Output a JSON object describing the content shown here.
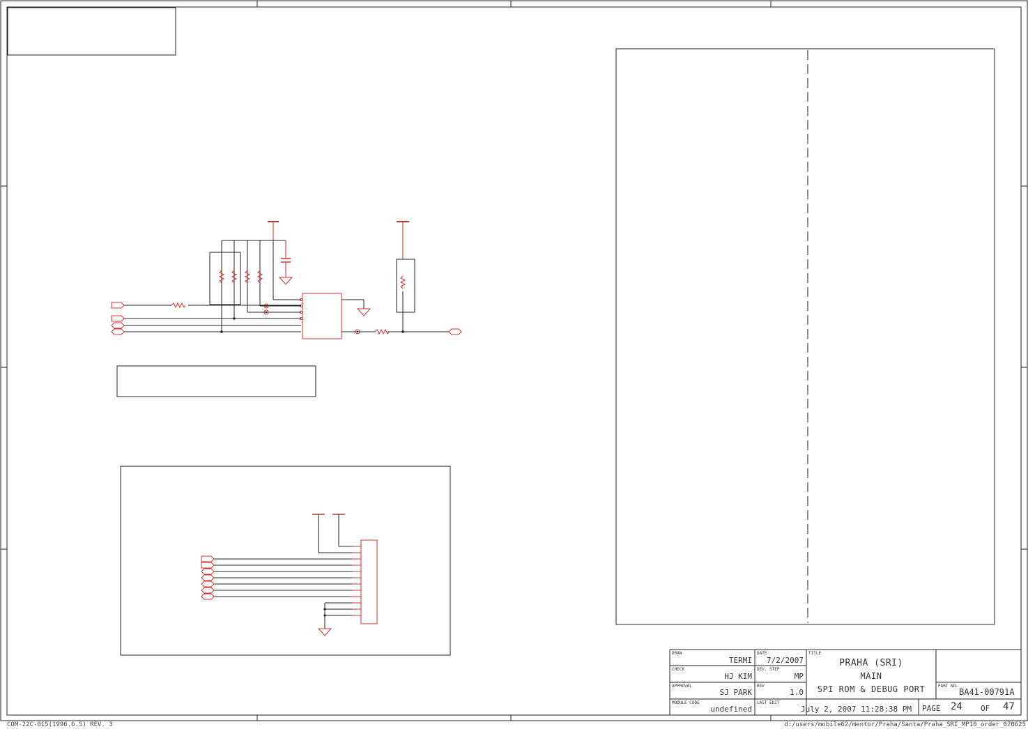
{
  "title_block": {
    "labels": {
      "draw": "DRAW",
      "check": "CHECK",
      "approval": "APPROVAL",
      "module_code": "MODULE CODE",
      "date": "DATE",
      "dev_step": "DEV. STEP",
      "rev": "REV",
      "last_edit": "LAST EDIT",
      "title": "TITLE",
      "part_no": "PART NO.",
      "page": "PAGE",
      "of": "OF"
    },
    "draw": "TERMI",
    "check": "HJ KIM",
    "approval": "SJ PARK",
    "module_code": "undefined",
    "date": "7/2/2007",
    "dev_step": "MP",
    "rev": "1.0",
    "last_edit": "July 2, 2007  11:28:38 PM",
    "title_lines": [
      "PRAHA (SRI)",
      "MAIN",
      "SPI ROM & DEBUG PORT"
    ],
    "part_no": "BA41-00791A",
    "page": "24",
    "total_pages": "47"
  },
  "footer": {
    "form_code": "COM-22C-015(1996.6.5) REV. 3",
    "file_path": "d:/users/mobile62/mentor/Praha/Santa/Praha_SRI_MP10_order_070625"
  },
  "colors": {
    "border": "#222222",
    "component": "#d32f2f",
    "wire": "#222222"
  }
}
